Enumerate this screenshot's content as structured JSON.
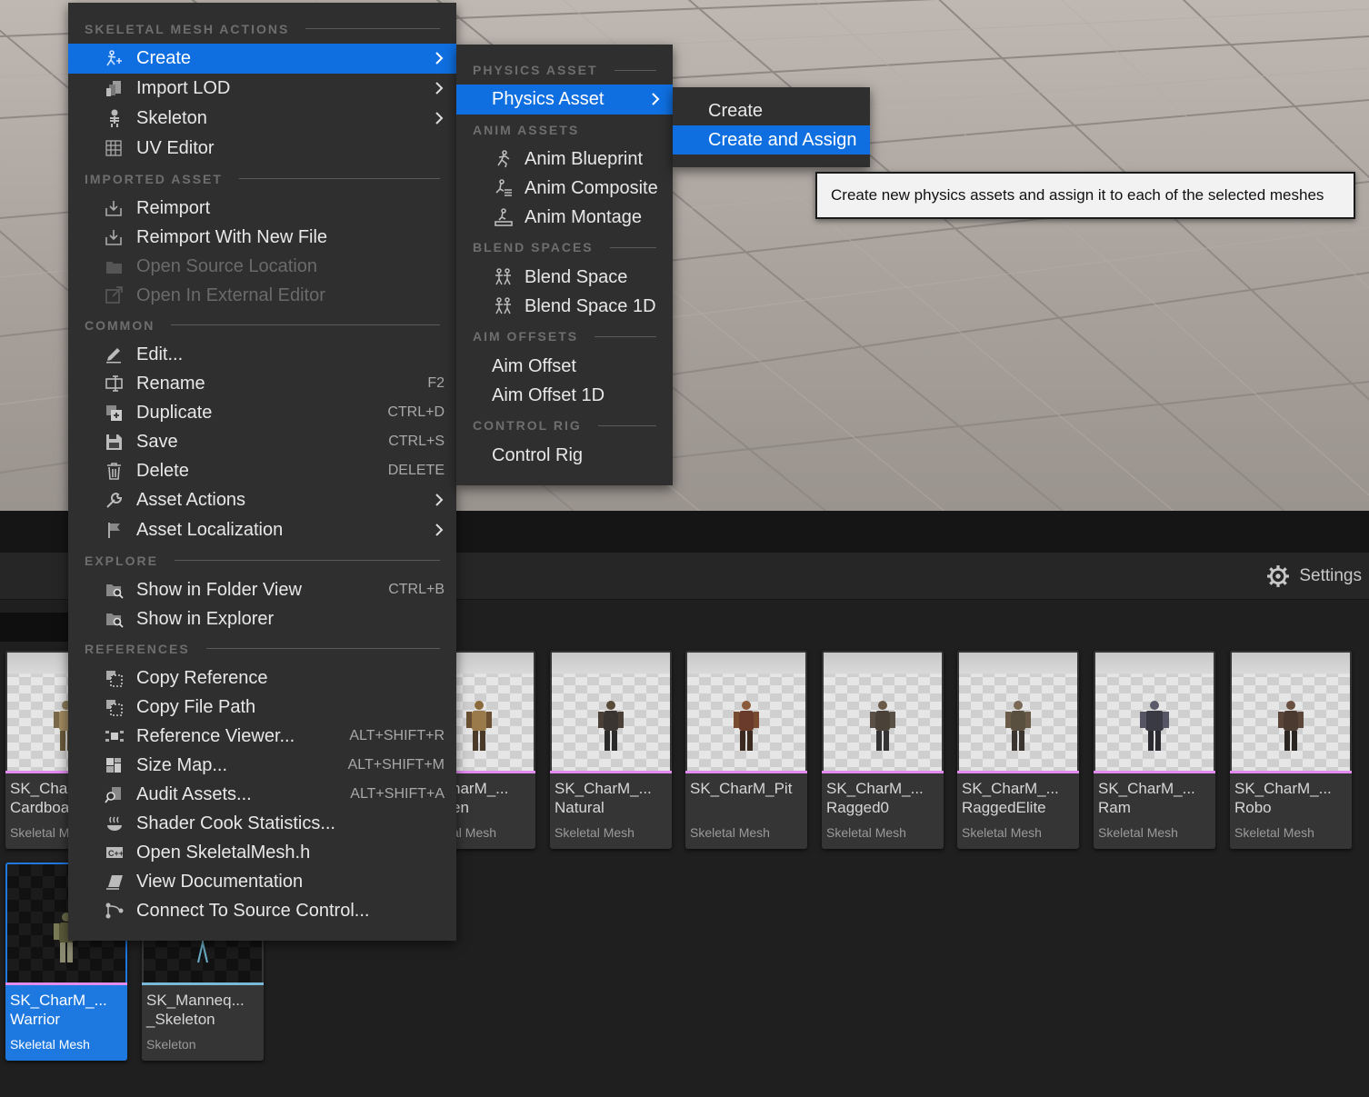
{
  "menu_main": {
    "sections": {
      "skeletal_mesh_actions": "SKELETAL MESH ACTIONS",
      "imported_asset": "IMPORTED ASSET",
      "common": "COMMON",
      "explore": "EXPLORE",
      "references": "REFERENCES"
    },
    "items": {
      "create": "Create",
      "import_lod": "Import LOD",
      "skeleton": "Skeleton",
      "uv_editor": "UV Editor",
      "reimport": "Reimport",
      "reimport_new": "Reimport With New File",
      "open_source": "Open Source Location",
      "open_external": "Open In External Editor",
      "edit": "Edit...",
      "rename": "Rename",
      "rename_sc": "F2",
      "duplicate": "Duplicate",
      "duplicate_sc": "CTRL+D",
      "save": "Save",
      "save_sc": "CTRL+S",
      "delete": "Delete",
      "delete_sc": "DELETE",
      "asset_actions": "Asset Actions",
      "asset_localization": "Asset Localization",
      "show_folder": "Show in Folder View",
      "show_folder_sc": "CTRL+B",
      "show_explorer": "Show in Explorer",
      "copy_reference": "Copy Reference",
      "copy_path": "Copy File Path",
      "ref_viewer": "Reference Viewer...",
      "ref_viewer_sc": "ALT+SHIFT+R",
      "size_map": "Size Map...",
      "size_map_sc": "ALT+SHIFT+M",
      "audit": "Audit Assets...",
      "audit_sc": "ALT+SHIFT+A",
      "shader_cook": "Shader Cook Statistics...",
      "open_header": "Open SkeletalMesh.h",
      "view_docs": "View Documentation",
      "source_control": "Connect To Source Control..."
    }
  },
  "menu_create": {
    "sections": {
      "physics_asset": "PHYSICS ASSET",
      "anim_assets": "ANIM ASSETS",
      "blend_spaces": "BLEND SPACES",
      "aim_offsets": "AIM OFFSETS",
      "control_rig": "CONTROL RIG"
    },
    "items": {
      "physics_asset": "Physics Asset",
      "anim_blueprint": "Anim Blueprint",
      "anim_composite": "Anim Composite",
      "anim_montage": "Anim Montage",
      "blend_space": "Blend Space",
      "blend_space_1d": "Blend Space 1D",
      "aim_offset": "Aim Offset",
      "aim_offset_1d": "Aim Offset 1D",
      "control_rig": "Control Rig"
    }
  },
  "menu_physics": {
    "create": "Create",
    "create_assign": "Create and Assign"
  },
  "tooltip": "Create new physics assets and assign it to each of the selected meshes",
  "toolbar": {
    "settings": "Settings"
  },
  "assets": [
    {
      "name": "SK_Char\nCardboa",
      "type": "Skeletal M"
    },
    {
      "name": "harM_...\nen",
      "type": "al Mesh"
    },
    {
      "name": "SK_CharM_...\nNatural",
      "type": "Skeletal Mesh"
    },
    {
      "name": "SK_CharM_Pit",
      "type": "Skeletal Mesh"
    },
    {
      "name": "SK_CharM_...\nRagged0",
      "type": "Skeletal Mesh"
    },
    {
      "name": "SK_CharM_...\nRaggedElite",
      "type": "Skeletal Mesh"
    },
    {
      "name": "SK_CharM_...\nRam",
      "type": "Skeletal Mesh"
    },
    {
      "name": "SK_CharM_...\nRobo",
      "type": "Skeletal Mesh"
    },
    {
      "name": "SK_CharM_...\nWarrior",
      "type": "Skeletal Mesh"
    },
    {
      "name": "SK_Manneq...\n_Skeleton",
      "type": "Skeleton"
    }
  ],
  "colors": {
    "accent": "#0f6fe0",
    "mesh_bar": "#e28cf0",
    "skeleton_bar": "#7ab8d8"
  }
}
